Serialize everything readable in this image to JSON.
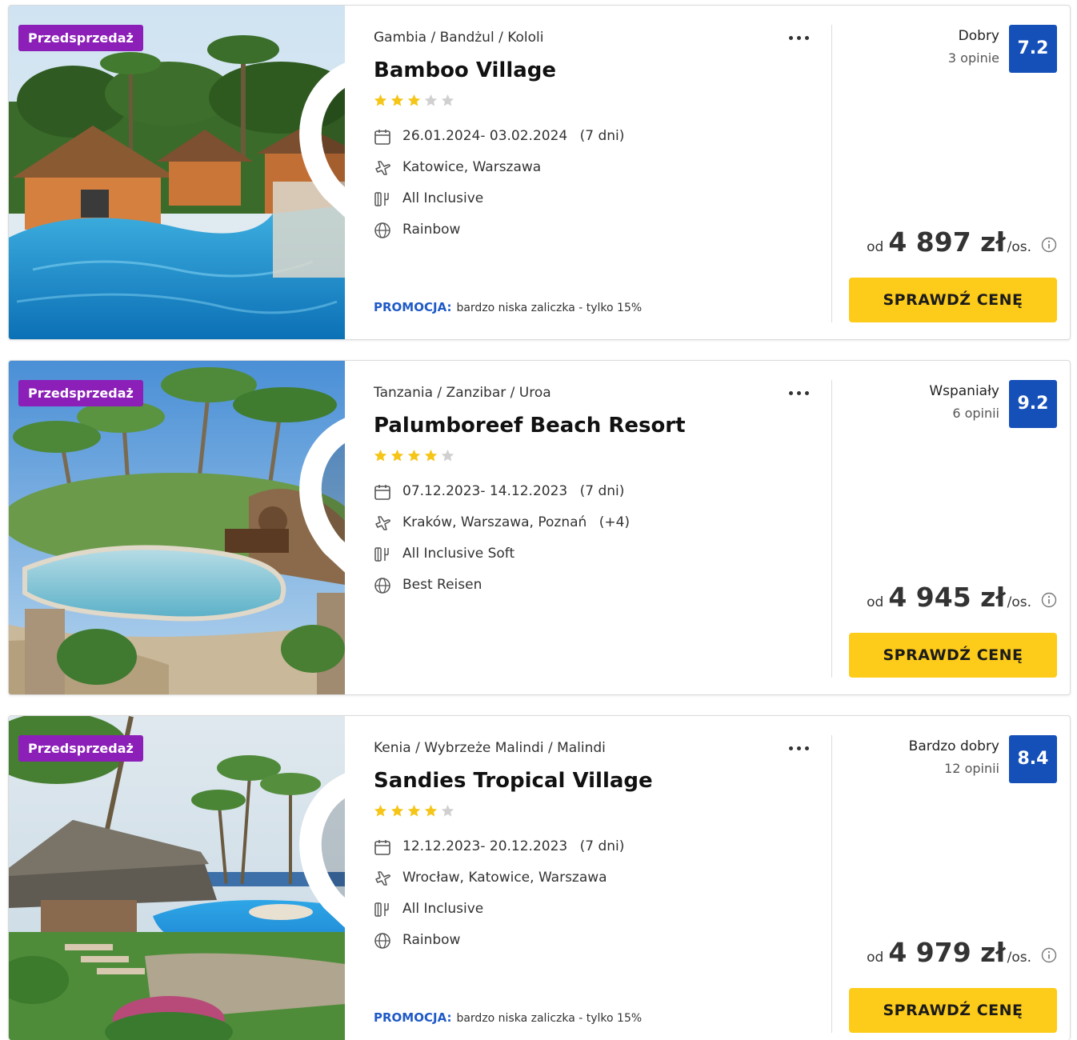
{
  "colors": {
    "badge": "#8b1fb7",
    "score": "#1550b8",
    "button": "#fdcb19",
    "promo": "#1f5ac7",
    "star_on": "#f5c518",
    "star_off": "#d0d0d0"
  },
  "icons": {
    "calendar": "calendar-icon",
    "flight": "airplane-icon",
    "board": "cutlery-icon",
    "operator": "globe-icon",
    "favorite": "heart-icon",
    "more": "more-dots-icon",
    "info": "info-icon"
  },
  "offers": [
    {
      "badge": "Przedsprzedaż",
      "location": "Gambia / Bandżul / Kololi",
      "name": "Bamboo Village",
      "stars": 3,
      "dates": "26.01.2024- 03.02.2024",
      "duration": "(7 dni)",
      "departures": "Katowice, Warszawa",
      "departures_extra": "",
      "board": "All Inclusive",
      "operator": "Rainbow",
      "promo_label": "PROMOCJA:",
      "promo_text": "bardzo niska zaliczka - tylko 15%",
      "rating_label": "Dobry",
      "rating_count": "3 opinie",
      "rating_score": "7.2",
      "price_prefix": "od",
      "price": "4 897 zł",
      "price_suffix": "/os.",
      "cta": "SPRAWDŹ CENĘ"
    },
    {
      "badge": "Przedsprzedaż",
      "location": "Tanzania / Zanzibar / Uroa",
      "name": "Palumboreef Beach Resort",
      "stars": 4,
      "dates": "07.12.2023- 14.12.2023",
      "duration": "(7 dni)",
      "departures": "Kraków, Warszawa, Poznań",
      "departures_extra": "(+4)",
      "board": "All Inclusive Soft",
      "operator": "Best Reisen",
      "promo_label": "",
      "promo_text": "",
      "rating_label": "Wspaniały",
      "rating_count": "6 opinii",
      "rating_score": "9.2",
      "price_prefix": "od",
      "price": "4 945 zł",
      "price_suffix": "/os.",
      "cta": "SPRAWDŹ CENĘ"
    },
    {
      "badge": "Przedsprzedaż",
      "location": "Kenia / Wybrzeże Malindi / Malindi",
      "name": "Sandies Tropical Village",
      "stars": 4,
      "dates": "12.12.2023- 20.12.2023",
      "duration": "(7 dni)",
      "departures": "Wrocław, Katowice, Warszawa",
      "departures_extra": "",
      "board": "All Inclusive",
      "operator": "Rainbow",
      "promo_label": "PROMOCJA:",
      "promo_text": "bardzo niska zaliczka - tylko 15%",
      "rating_label": "Bardzo dobry",
      "rating_count": "12 opinii",
      "rating_score": "8.4",
      "price_prefix": "od",
      "price": "4 979 zł",
      "price_suffix": "/os.",
      "cta": "SPRAWDŹ CENĘ"
    }
  ]
}
